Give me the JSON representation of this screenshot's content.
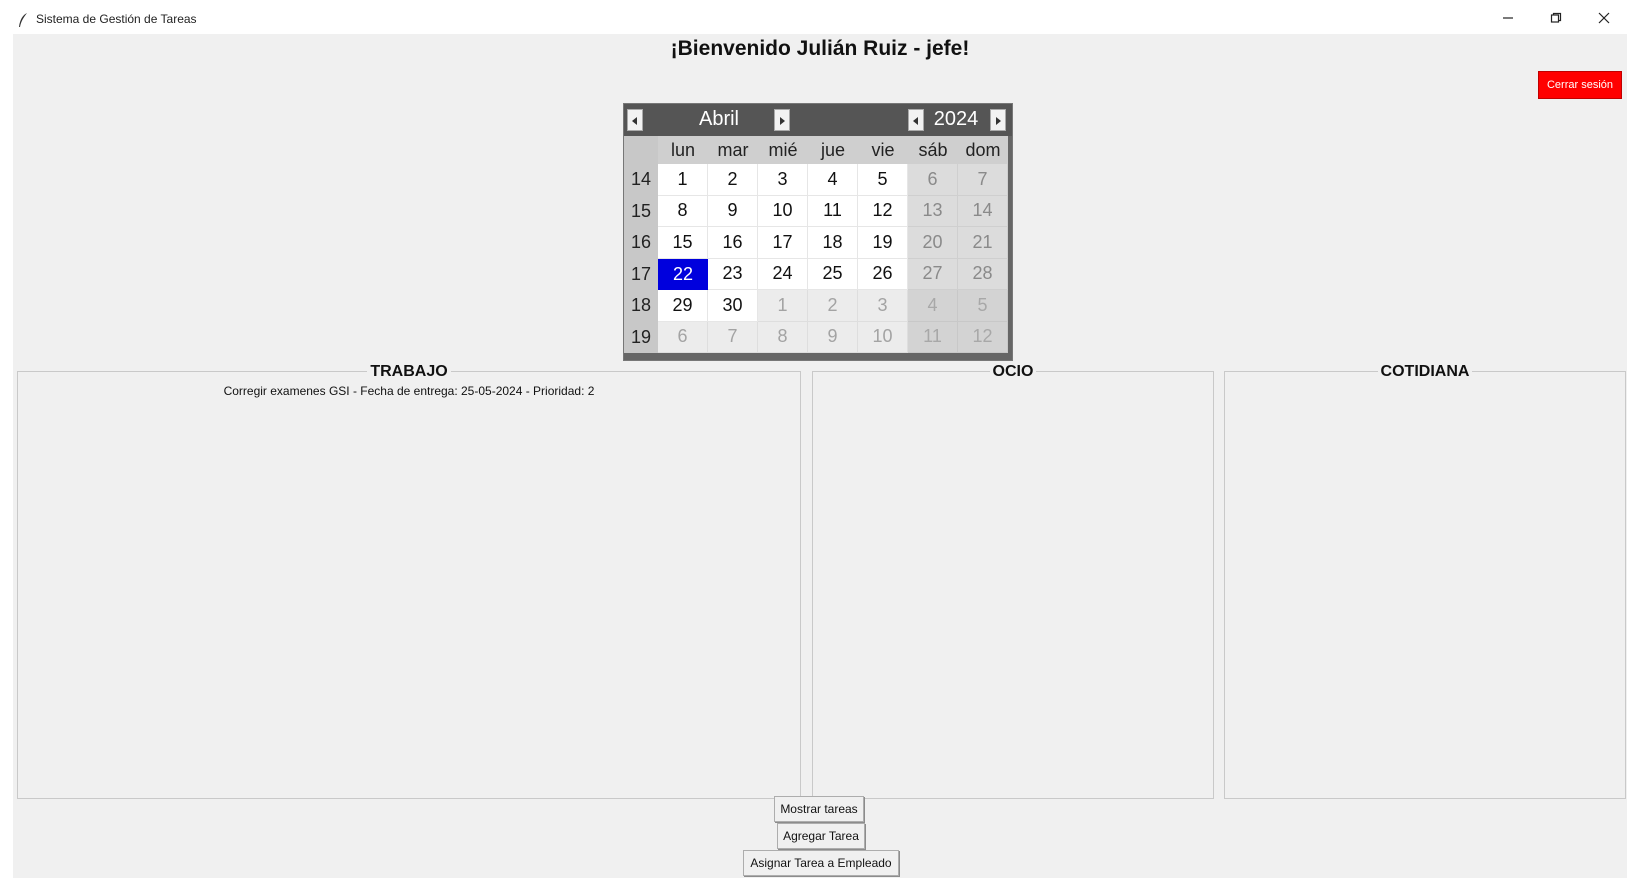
{
  "window": {
    "title": "Sistema de Gestión de Tareas",
    "controls": {
      "minimize": "–",
      "maximize": "❐",
      "close": "✕"
    }
  },
  "header": {
    "welcome": "¡Bienvenido Julián Ruiz - jefe!",
    "logout_label": "Cerrar sesión",
    "logout_color": "#ff0000"
  },
  "calendar": {
    "month": "Abril",
    "year": "2024",
    "weekday_headers": [
      "lun",
      "mar",
      "mié",
      "jue",
      "vie",
      "sáb",
      "dom"
    ],
    "weeks": [
      {
        "num": "14",
        "days": [
          "1",
          "2",
          "3",
          "4",
          "5",
          "6",
          "7"
        ]
      },
      {
        "num": "15",
        "days": [
          "8",
          "9",
          "10",
          "11",
          "12",
          "13",
          "14"
        ]
      },
      {
        "num": "16",
        "days": [
          "15",
          "16",
          "17",
          "18",
          "19",
          "20",
          "21"
        ]
      },
      {
        "num": "17",
        "days": [
          "22",
          "23",
          "24",
          "25",
          "26",
          "27",
          "28"
        ]
      },
      {
        "num": "18",
        "days": [
          "29",
          "30",
          "1",
          "2",
          "3",
          "4",
          "5"
        ]
      },
      {
        "num": "19",
        "days": [
          "6",
          "7",
          "8",
          "9",
          "10",
          "11",
          "12"
        ]
      }
    ],
    "selected_day": "22",
    "selected_color": "#0000dd"
  },
  "groups": [
    {
      "title": "TRABAJO",
      "tasks": [
        "Corregir examenes GSI - Fecha de entrega: 25-05-2024 - Prioridad: 2"
      ]
    },
    {
      "title": "OCIO",
      "tasks": []
    },
    {
      "title": "COTIDIANA",
      "tasks": []
    }
  ],
  "buttons": {
    "show_tasks": "Mostrar tareas",
    "add_task": "Agregar Tarea",
    "assign_task": "Asignar Tarea a Empleado"
  }
}
